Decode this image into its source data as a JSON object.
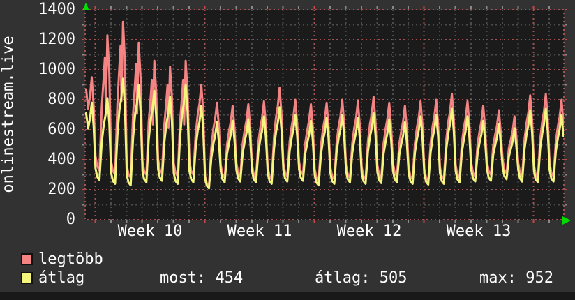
{
  "header": {
    "vertical_axis_title": "onlinestream.live"
  },
  "colors": {
    "page_bg": "#323232",
    "plot_bg": "#1b1b1b",
    "bottom_strip": "#191919",
    "grid_minor": "#4c4c4c",
    "grid_major": "#a35151",
    "tick_minor": "#8a8a8a",
    "tick_major": "#cc4444",
    "arrow": "#00dd00",
    "text": "#ffffff",
    "series_red": "#f48484",
    "series_yellow": "#f5f57d"
  },
  "legend": [
    {
      "label": "legtöbb",
      "color": "#f48484"
    },
    {
      "label": "átlag",
      "color": "#f5f57d"
    }
  ],
  "stats": [
    {
      "label": "most",
      "value": "454",
      "text": "most: 454"
    },
    {
      "label": "átlag",
      "value": "505",
      "text": "átlag: 505"
    },
    {
      "label": "max",
      "value": "952",
      "text": "max: 952"
    }
  ],
  "chart_data": {
    "type": "line",
    "title": "onlinestream.live",
    "ylabel": "onlinestream.live",
    "grid": "on",
    "legend_position": "bottom-left",
    "y_axis": {
      "min": 0,
      "max": 1400,
      "major_step": 200,
      "minor_step": 100,
      "tick_labels": [
        "0",
        "200",
        "400",
        "600",
        "800",
        "1000",
        "1200",
        "1400"
      ]
    },
    "x_axis": {
      "unit": "days",
      "week_labels": [
        "Week 10",
        "Week 11",
        "Week 12",
        "Week 13"
      ],
      "days_per_week": 7,
      "visible_range_days": [
        -0.64,
        29.93
      ],
      "note": "red dotted gridlines at week boundaries, gray dotted gridlines daily"
    },
    "daily_format": "p = evening peak value, t = morning trough value, day 0 = start of Week 10",
    "series": [
      {
        "name": "legtöbb",
        "color": "#f48484",
        "daily": [
          {
            "p": 950,
            "t": 860
          },
          {
            "p": 1230,
            "t": 330
          },
          {
            "p": 1320,
            "t": 300
          },
          {
            "p": 1180,
            "t": 280
          },
          {
            "p": 1060,
            "t": 300
          },
          {
            "p": 1020,
            "t": 310
          },
          {
            "p": 1060,
            "t": 290
          },
          {
            "p": 900,
            "t": 300
          },
          {
            "p": 780,
            "t": 225
          },
          {
            "p": 760,
            "t": 280
          },
          {
            "p": 770,
            "t": 290
          },
          {
            "p": 790,
            "t": 280
          },
          {
            "p": 880,
            "t": 270
          },
          {
            "p": 800,
            "t": 290
          },
          {
            "p": 770,
            "t": 300
          },
          {
            "p": 780,
            "t": 260
          },
          {
            "p": 800,
            "t": 270
          },
          {
            "p": 790,
            "t": 280
          },
          {
            "p": 820,
            "t": 270
          },
          {
            "p": 780,
            "t": 280
          },
          {
            "p": 760,
            "t": 290
          },
          {
            "p": 790,
            "t": 270
          },
          {
            "p": 800,
            "t": 260
          },
          {
            "p": 840,
            "t": 270
          },
          {
            "p": 790,
            "t": 280
          },
          {
            "p": 760,
            "t": 290
          },
          {
            "p": 730,
            "t": 300
          },
          {
            "p": 690,
            "t": 310
          },
          {
            "p": 830,
            "t": 290
          },
          {
            "p": 840,
            "t": 280
          },
          {
            "p": 800,
            "t": 290
          }
        ]
      },
      {
        "name": "átlag",
        "color": "#f5f57d",
        "daily": [
          {
            "p": 780,
            "t": 700
          },
          {
            "p": 810,
            "t": 265
          },
          {
            "p": 940,
            "t": 240
          },
          {
            "p": 900,
            "t": 230
          },
          {
            "p": 860,
            "t": 250
          },
          {
            "p": 820,
            "t": 260
          },
          {
            "p": 900,
            "t": 240
          },
          {
            "p": 760,
            "t": 250
          },
          {
            "p": 650,
            "t": 210
          },
          {
            "p": 660,
            "t": 250
          },
          {
            "p": 670,
            "t": 255
          },
          {
            "p": 690,
            "t": 250
          },
          {
            "p": 750,
            "t": 240
          },
          {
            "p": 700,
            "t": 255
          },
          {
            "p": 660,
            "t": 260
          },
          {
            "p": 680,
            "t": 230
          },
          {
            "p": 700,
            "t": 240
          },
          {
            "p": 680,
            "t": 250
          },
          {
            "p": 710,
            "t": 240
          },
          {
            "p": 670,
            "t": 245
          },
          {
            "p": 650,
            "t": 250
          },
          {
            "p": 690,
            "t": 240
          },
          {
            "p": 700,
            "t": 235
          },
          {
            "p": 740,
            "t": 240
          },
          {
            "p": 690,
            "t": 250
          },
          {
            "p": 660,
            "t": 255
          },
          {
            "p": 640,
            "t": 260
          },
          {
            "p": 610,
            "t": 270
          },
          {
            "p": 730,
            "t": 255
          },
          {
            "p": 740,
            "t": 250
          },
          {
            "p": 700,
            "t": 255
          }
        ]
      }
    ],
    "summary": {
      "most": 454,
      "atlag": 505,
      "max": 952
    }
  }
}
